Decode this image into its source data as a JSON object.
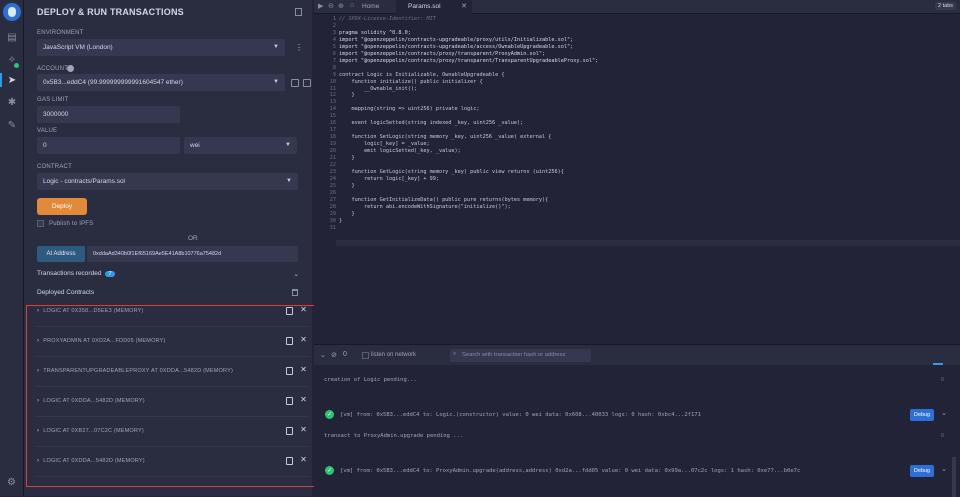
{
  "panel": {
    "title": "DEPLOY & RUN TRANSACTIONS",
    "environment_label": "ENVIRONMENT",
    "environment_value": "JavaScript VM (London)",
    "account_label": "ACCOUNT",
    "account_value": "0x5B3...eddC4 (99.999999999991604547 ether)",
    "gas_label": "GAS LIMIT",
    "gas_value": "3000000",
    "value_label": "VALUE",
    "value_amount": "0",
    "value_unit": "wei",
    "contract_label": "CONTRACT",
    "contract_value": "Logic - contracts/Params.sol",
    "deploy_label": "Deploy",
    "publish_label": "Publish to IPFS",
    "or_label": "OR",
    "at_address_label": "At Address",
    "at_address_value": "0xddaAd340b0f1Ef65169Ae5E41A8b10776a75482d",
    "tx_recorded_label": "Transactions recorded",
    "tx_recorded_count": "7",
    "deployed_label": "Deployed Contracts",
    "deployed_contracts": [
      "LOGIC AT 0X358...D5EE3 (MEMORY)",
      "PROXYADMIN AT 0XD2A...FDD05 (MEMORY)",
      "TRANSPARENTUPGRADEABLEPROXY AT 0XDDA...5482D (MEMORY)",
      "LOGIC AT 0XDDA...5482D (MEMORY)",
      "LOGIC AT 0XB27...07C2C (MEMORY)",
      "LOGIC AT 0XDDA...5482D (MEMORY)"
    ]
  },
  "editor": {
    "home_tab": "Home",
    "file_tab": "Params.sol",
    "tabs_count": "2 tabs",
    "code": [
      {
        "n": "1",
        "t": "// SPDX-License-Identifier: MIT"
      },
      {
        "n": "2",
        "t": ""
      },
      {
        "n": "3",
        "t": "pragma solidity ^0.8.0;"
      },
      {
        "n": "4",
        "t": "import \"@openzeppelin/contracts-upgradeable/proxy/utils/Initializable.sol\";"
      },
      {
        "n": "5",
        "t": "import \"@openzeppelin/contracts-upgradeable/access/OwnableUpgradeable.sol\";"
      },
      {
        "n": "6",
        "t": "import \"@openzeppelin/contracts/proxy/transparent/ProxyAdmin.sol\";"
      },
      {
        "n": "7",
        "t": "import \"@openzeppelin/contracts/proxy/transparent/TransparentUpgradeableProxy.sol\";"
      },
      {
        "n": "8",
        "t": ""
      },
      {
        "n": "9",
        "t": "contract Logic is Initializable, OwnableUpgradeable {"
      },
      {
        "n": "10",
        "t": "    function initialize() public initializer {"
      },
      {
        "n": "11",
        "t": "        __Ownable_init();"
      },
      {
        "n": "12",
        "t": "    }"
      },
      {
        "n": "13",
        "t": ""
      },
      {
        "n": "14",
        "t": "    mapping(string => uint256) private logic;"
      },
      {
        "n": "15",
        "t": ""
      },
      {
        "n": "16",
        "t": "    event logicSetted(string indexed _key, uint256 _value);"
      },
      {
        "n": "17",
        "t": ""
      },
      {
        "n": "18",
        "t": "    function SetLogic(string memory _key, uint256 _value) external {"
      },
      {
        "n": "19",
        "t": "        logic[_key] = _value;"
      },
      {
        "n": "20",
        "t": "        emit logicSetted(_key, _value);"
      },
      {
        "n": "21",
        "t": "    }"
      },
      {
        "n": "22",
        "t": ""
      },
      {
        "n": "23",
        "t": "    function GetLogic(string memory _key) public view returns (uint256){"
      },
      {
        "n": "24",
        "t": "        return logic[_key] + 99;"
      },
      {
        "n": "25",
        "t": "    }"
      },
      {
        "n": "26",
        "t": ""
      },
      {
        "n": "27",
        "t": "    function GetInitializeData() public pure returns(bytes memory){"
      },
      {
        "n": "28",
        "t": "        return abi.encodeWithSignature(\"initialize()\");"
      },
      {
        "n": "29",
        "t": "    }"
      },
      {
        "n": "30",
        "t": "}"
      },
      {
        "n": "31",
        "t": ""
      }
    ]
  },
  "terminal": {
    "counter": "0",
    "listen_label": "listen on network",
    "search_placeholder": "Search with transaction hash or address",
    "line1": "creation of Logic pending...",
    "tx1": "[vm]  from: 0x5B3...eddC4 to: Logic.(constructor) value: 0 wei data: 0x608...40033 logs: 0 hash: 0xbc4...2f171",
    "line2": "transact to ProxyAdmin.upgrade pending ...",
    "tx2": "[vm]  from: 0x5B3...eddC4 to: ProxyAdmin.upgrade(address,address) 0xd2a...fdd05 value: 0 wei data: 0x99a...07c2c logs: 1 hash: 0xe77...b0e7c",
    "debug_label": "Debug",
    "zero": "0"
  }
}
